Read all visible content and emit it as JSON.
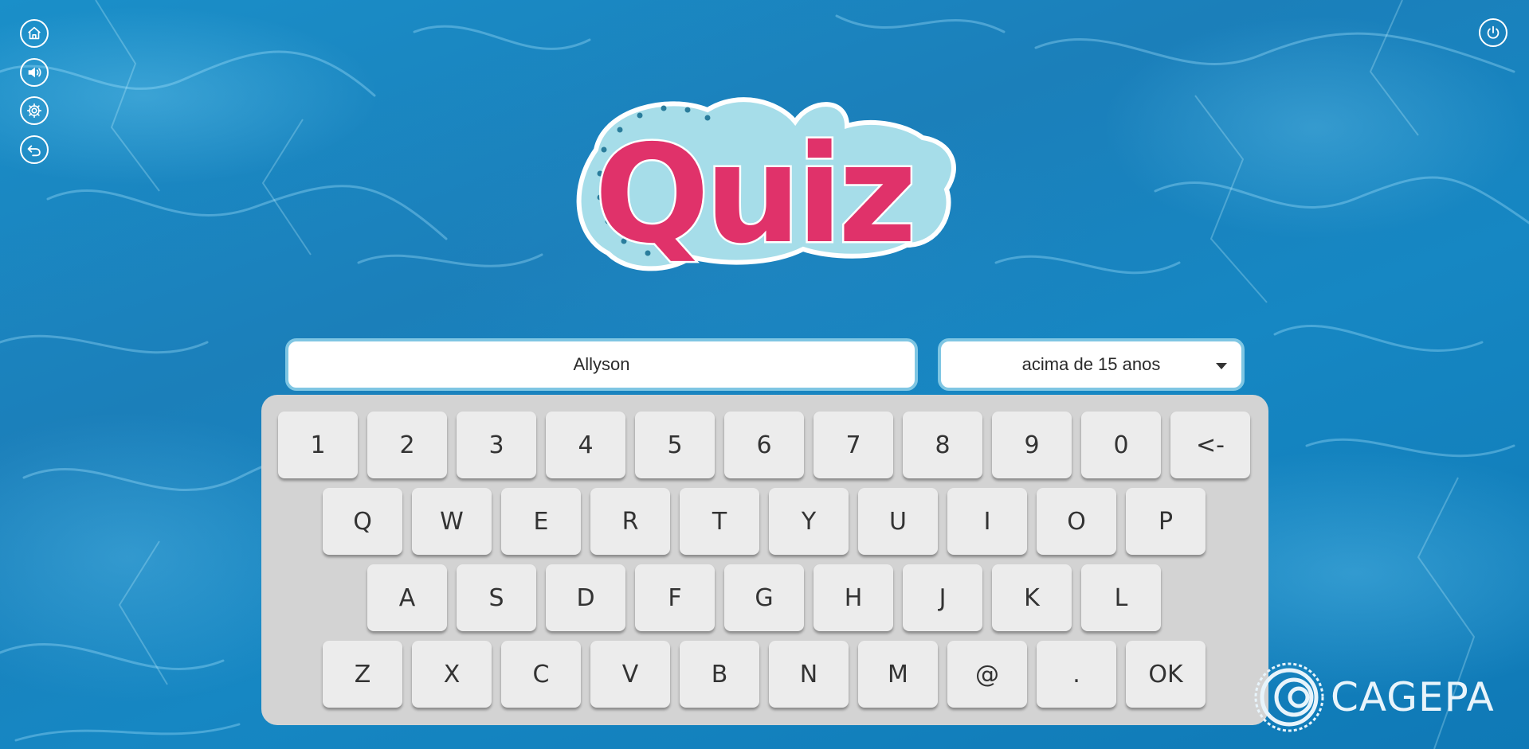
{
  "side_buttons": [
    {
      "name": "home-button",
      "icon": "home-icon"
    },
    {
      "name": "sound-button",
      "icon": "speaker-icon"
    },
    {
      "name": "settings-button",
      "icon": "gear-icon"
    },
    {
      "name": "back-button",
      "icon": "undo-icon"
    }
  ],
  "power_button": {
    "icon": "power-icon"
  },
  "logo": {
    "text": "Quiz"
  },
  "name_input": {
    "value": "Allyson"
  },
  "age_select": {
    "selected": "acima de 15 anos"
  },
  "keyboard": {
    "rows": [
      [
        "1",
        "2",
        "3",
        "4",
        "5",
        "6",
        "7",
        "8",
        "9",
        "0",
        "<-"
      ],
      [
        "Q",
        "W",
        "E",
        "R",
        "T",
        "Y",
        "U",
        "I",
        "O",
        "P"
      ],
      [
        "A",
        "S",
        "D",
        "F",
        "G",
        "H",
        "J",
        "K",
        "L"
      ],
      [
        "Z",
        "X",
        "C",
        "V",
        "B",
        "N",
        "M",
        "@",
        ".",
        "OK"
      ]
    ]
  },
  "brand": {
    "text": "CAGEPA"
  },
  "colors": {
    "logo_pink": "#e0326a",
    "logo_light_blue": "#a6dde9",
    "key_bg": "#ececec",
    "keyboard_bg": "#d3d3d3",
    "field_border": "#7fc6e3"
  }
}
